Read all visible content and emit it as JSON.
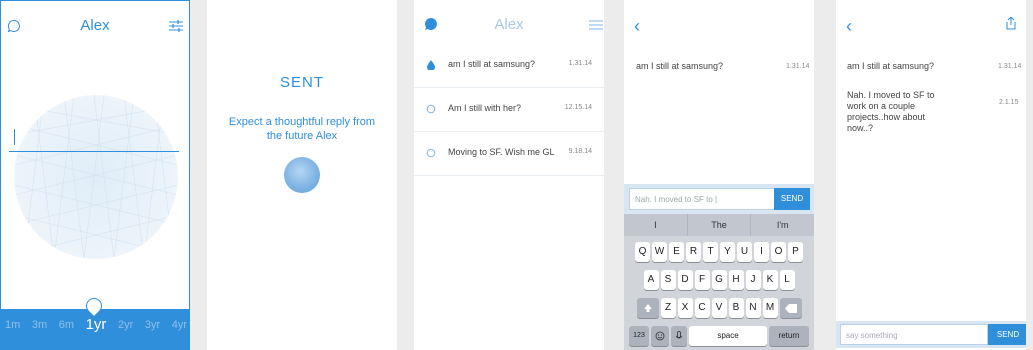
{
  "screen1": {
    "title": "Alex",
    "chat_icon": "chat-bubble-icon",
    "filter_icon": "sliders-icon",
    "time_options": [
      "1m",
      "3m",
      "6m",
      "1yr",
      "2yr",
      "3yr",
      "4yr"
    ],
    "selected_option": "1yr"
  },
  "screen2": {
    "heading": "SENT",
    "message": "Expect a thoughtful reply from the future Alex"
  },
  "screen3": {
    "title": "Alex",
    "rows": [
      {
        "text": "am I still at samsung?",
        "time": "1.31.14"
      },
      {
        "text": "Am I still with her?",
        "time": "12.15.14"
      },
      {
        "text": "Moving to SF. Wish me GL",
        "time": "9.18.14"
      }
    ]
  },
  "screen4": {
    "back": "‹",
    "message": "am I still at samsung?",
    "message_time": "1.31.14",
    "input_value": "Nah. I moved to SF to |",
    "send": "SEND",
    "suggestions": [
      "I",
      "The",
      "I'm"
    ],
    "keys_row1": [
      "Q",
      "W",
      "E",
      "R",
      "T",
      "Y",
      "U",
      "I",
      "O",
      "P"
    ],
    "keys_row2": [
      "A",
      "S",
      "D",
      "F",
      "G",
      "H",
      "J",
      "K",
      "L"
    ],
    "keys_row3": [
      "Z",
      "X",
      "C",
      "V",
      "B",
      "N",
      "M"
    ],
    "key_123": "123",
    "key_space": "space",
    "key_return": "return"
  },
  "screen5": {
    "back": "‹",
    "message1": "am I still at samsung?",
    "message1_time": "1.31.14",
    "message2": "Nah. I moved to SF to work on a couple projects..how about now..?",
    "message2_time": "2.1.15",
    "placeholder": "say something",
    "send": "SEND"
  }
}
